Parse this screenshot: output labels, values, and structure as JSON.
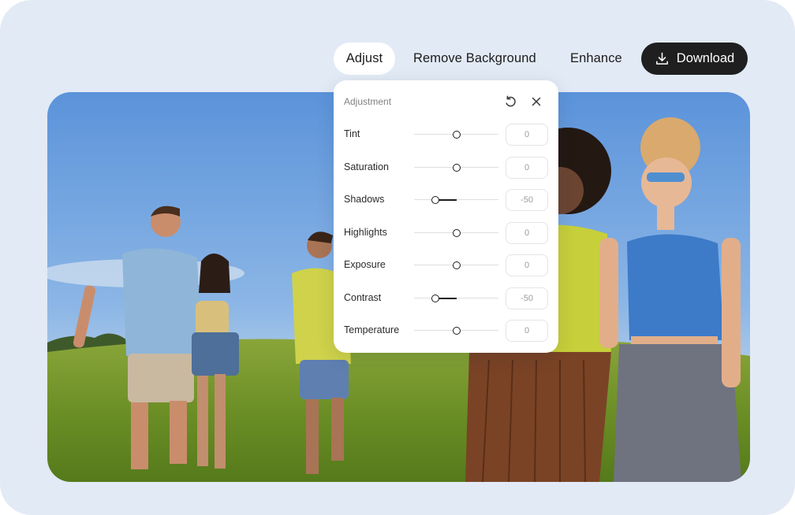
{
  "toolbar": {
    "tabs": [
      {
        "label": "Adjust",
        "active": true
      },
      {
        "label": "Remove Background",
        "active": false
      },
      {
        "label": "Enhance",
        "active": false
      }
    ],
    "download_label": "Download",
    "download_icon": "download-icon"
  },
  "panel": {
    "title": "Adjustment",
    "reset_icon": "reset-icon",
    "close_icon": "close-icon",
    "slider_range": [
      -100,
      100
    ],
    "rows": [
      {
        "label": "Tint",
        "value": "0"
      },
      {
        "label": "Saturation",
        "value": "0"
      },
      {
        "label": "Shadows",
        "value": "-50"
      },
      {
        "label": "Highlights",
        "value": "0"
      },
      {
        "label": "Exposure",
        "value": "0"
      },
      {
        "label": "Contrast",
        "value": "-50"
      },
      {
        "label": "Temperature",
        "value": "0"
      }
    ]
  },
  "photo": {
    "subject": "group of friends walking on grass under blue sky"
  },
  "colors": {
    "background": "#e2eaf5",
    "download_button": "#1f1f1f",
    "active_tab": "#ffffff"
  }
}
